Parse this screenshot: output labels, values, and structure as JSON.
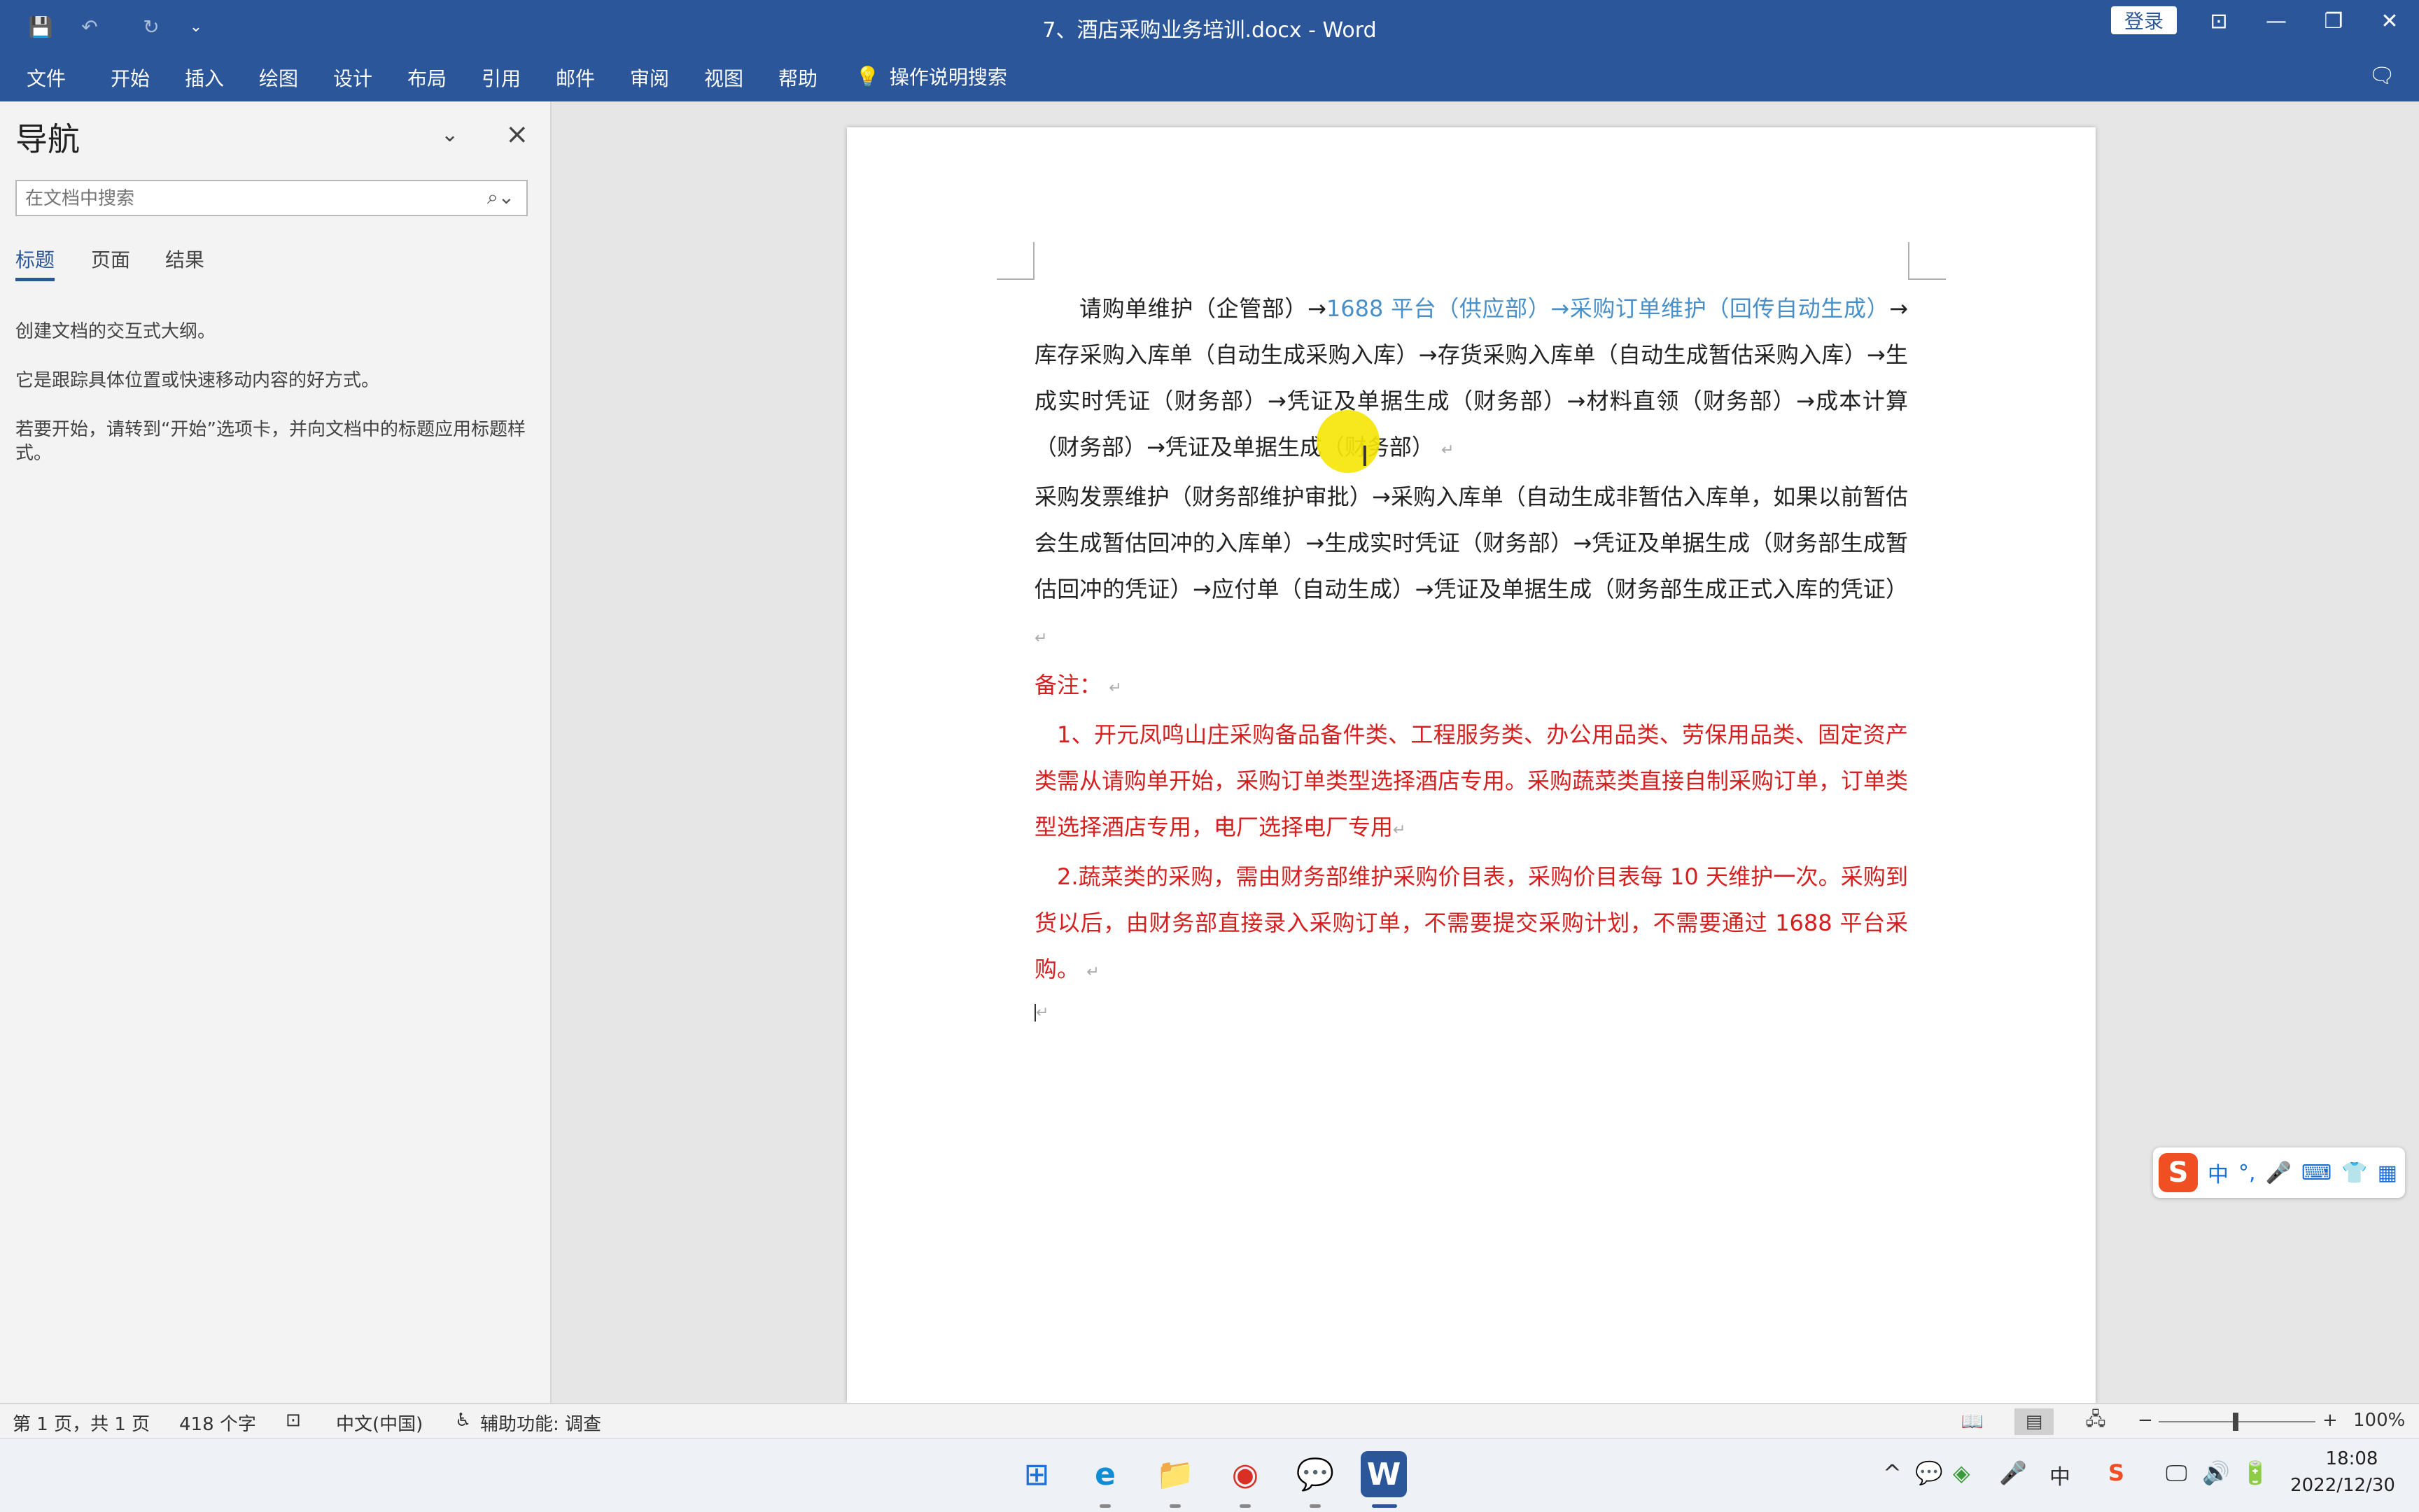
{
  "window": {
    "title": "7、酒店采购业务培训.docx  -  Word",
    "signin": "登录",
    "quick_access": {
      "save": "💾",
      "undo": "↶",
      "redo": "↻",
      "customize": "⌄"
    },
    "controls": {
      "ribbon_display": "⊡",
      "minimize": "—",
      "restore": "❐",
      "close": "✕"
    }
  },
  "ribbon": {
    "tabs": [
      "文件",
      "开始",
      "插入",
      "绘图",
      "设计",
      "布局",
      "引用",
      "邮件",
      "审阅",
      "视图",
      "帮助"
    ],
    "tell_me": "操作说明搜索",
    "tell_me_icon": "💡",
    "comment_icon": "🗨"
  },
  "nav": {
    "title": "导航",
    "search_placeholder": "在文档中搜索",
    "search_icon": "⌕⌄",
    "tabs": [
      "标题",
      "页面",
      "结果"
    ],
    "hints": [
      "创建文档的交互式大纲。",
      "它是跟踪具体位置或快速移动内容的好方式。",
      "若要开始，请转到“开始”选项卡，并向文档中的标题应用标题样式。"
    ]
  },
  "document": {
    "p1_pre": "请购单维护（企管部）→",
    "p1_blue": "1688 平台（供应部）→采购订单维护（回传自动生成）",
    "p1_post": "→库存采购入库单（自动生成采购入库）→存货采购入库单（自动生成暂估采购入库）→生成实时凭证（财务部）→凭证及单据生成（财务部）→材料直领（财务部）→成本计算（财务部）→凭证及单据生成（财务部）",
    "p2": "采购发票维护（财务部维护审批）→采购入库单（自动生成非暂估入库单，如果以前暂估会生成暂估回冲的入库单）→生成实时凭证（财务部）→凭证及单据生成（财务部生成暂估回冲的凭证）→应付单（自动生成）→凭证及单据生成（财务部生成正式入库的凭证）",
    "note_label": "备注：",
    "note1": "1、开元凤鸣山庄采购备品备件类、工程服务类、办公用品类、劳保用品类、固定资产类需从请购单开始，采购订单类型选择酒店专用。采购蔬菜类直接自制采购订单，订单类型选择酒店专用，电厂选择电厂专用",
    "note2": "2.蔬菜类的采购，需由财务部维护采购价目表，采购价目表每 10 天维护一次。采购到货以后，由财务部直接录入采购订单，不需要提交采购计划，不需要通过 1688 平台采购。",
    "para_mark": "↵",
    "ibeam": "I"
  },
  "ime": {
    "logo": "S",
    "items": [
      "中",
      "°,",
      "🎤",
      "⌨",
      "👕",
      "▦"
    ]
  },
  "status": {
    "page": "第 1 页，共 1 页",
    "words": "418 个字",
    "track_icon": "⊡",
    "language": "中文(中国)",
    "accessibility": "辅助功能: 调查",
    "accessibility_icon": "♿",
    "views": [
      "📖",
      "▤",
      "🖧"
    ],
    "zoom_minus": "−",
    "zoom_plus": "+",
    "zoom": "100%"
  },
  "taskbar": {
    "apps": [
      "⊞",
      "e",
      "📁",
      "◉",
      "💬",
      "W"
    ],
    "tray": [
      "^",
      "💬",
      "◈",
      "🎤",
      "中",
      "S",
      "🖵",
      "🔊",
      "🔋"
    ],
    "time": "18:08",
    "date": "2022/12/30"
  }
}
